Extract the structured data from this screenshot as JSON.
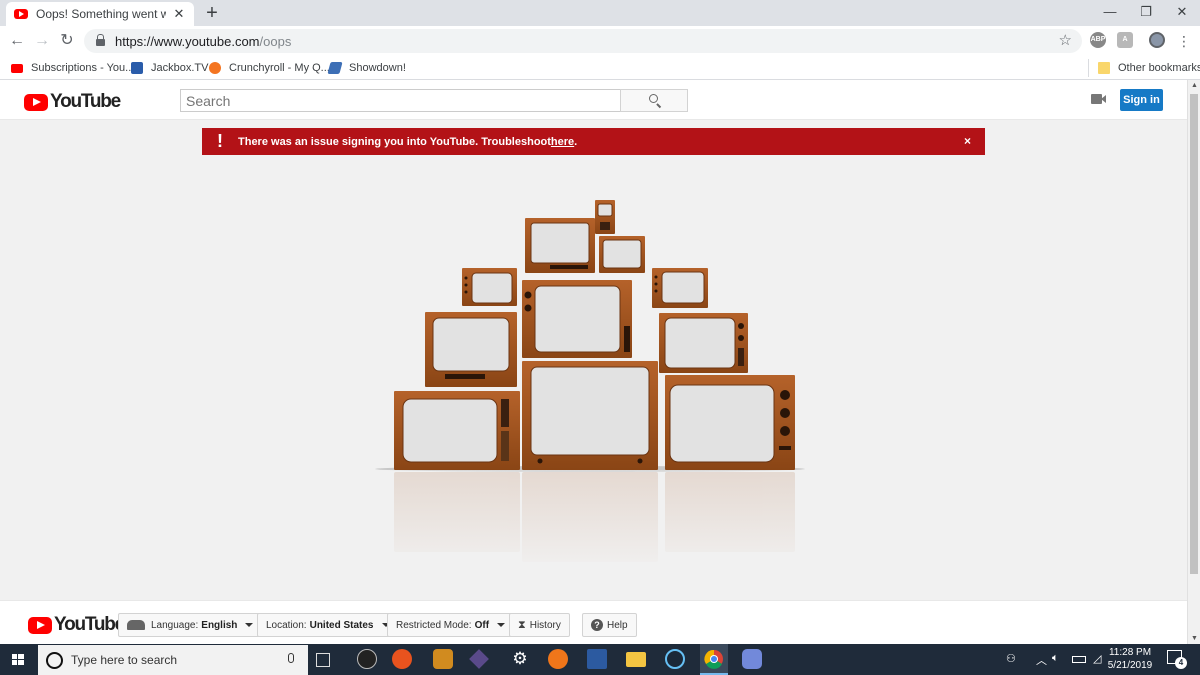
{
  "browser": {
    "tab_title": "Oops! Something went wrong. -",
    "url_host": "https://www.youtube.com",
    "url_path": "/oops",
    "bookmarks": [
      {
        "label": "Subscriptions - You...",
        "icon": "youtube-icon",
        "color": "#ff0000"
      },
      {
        "label": "Jackbox.TV",
        "icon": "jackbox-icon",
        "color": "#2a5caa"
      },
      {
        "label": "Crunchyroll - My Q...",
        "icon": "crunchyroll-icon",
        "color": "#f47521"
      },
      {
        "label": "Showdown!",
        "icon": "showdown-icon",
        "color": "#3d6fb6"
      }
    ],
    "other_bookmarks": "Other bookmarks",
    "extensions": [
      "ABP",
      "A"
    ]
  },
  "youtube": {
    "logo_text": "YouTube",
    "search_placeholder": "Search",
    "sign_in": "Sign in",
    "alert": {
      "icon": "!",
      "message": "There was an issue signing you into YouTube. Troubleshoot ",
      "link": "here",
      "suffix": ".",
      "close": "×"
    },
    "footer": {
      "language_label": "Language:",
      "language_value": "English",
      "location_label": "Location:",
      "location_value": "United States",
      "restricted_label": "Restricted Mode:",
      "restricted_value": "Off",
      "history": "History",
      "help": "Help"
    }
  },
  "taskbar": {
    "search_placeholder": "Type here to search",
    "time": "11:28 PM",
    "date": "5/21/2019",
    "notification_count": "4"
  },
  "colors": {
    "alert_red": "#b31217",
    "youtube_red": "#ff0000",
    "signin_blue": "#167ac6",
    "tv_wood": "#a0521e",
    "taskbar": "#1f2b3a"
  }
}
